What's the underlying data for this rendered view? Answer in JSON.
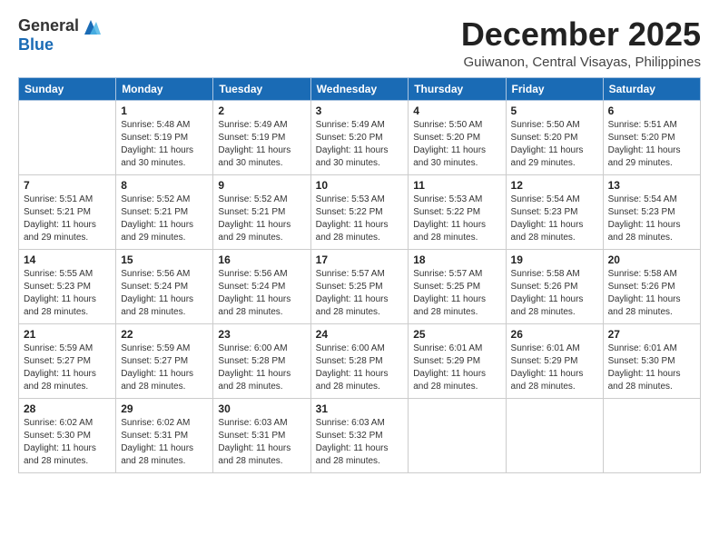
{
  "logo": {
    "general": "General",
    "blue": "Blue"
  },
  "title": "December 2025",
  "location": "Guiwanon, Central Visayas, Philippines",
  "days_of_week": [
    "Sunday",
    "Monday",
    "Tuesday",
    "Wednesday",
    "Thursday",
    "Friday",
    "Saturday"
  ],
  "weeks": [
    [
      {
        "day": "",
        "info": ""
      },
      {
        "day": "1",
        "info": "Sunrise: 5:48 AM\nSunset: 5:19 PM\nDaylight: 11 hours\nand 30 minutes."
      },
      {
        "day": "2",
        "info": "Sunrise: 5:49 AM\nSunset: 5:19 PM\nDaylight: 11 hours\nand 30 minutes."
      },
      {
        "day": "3",
        "info": "Sunrise: 5:49 AM\nSunset: 5:20 PM\nDaylight: 11 hours\nand 30 minutes."
      },
      {
        "day": "4",
        "info": "Sunrise: 5:50 AM\nSunset: 5:20 PM\nDaylight: 11 hours\nand 30 minutes."
      },
      {
        "day": "5",
        "info": "Sunrise: 5:50 AM\nSunset: 5:20 PM\nDaylight: 11 hours\nand 29 minutes."
      },
      {
        "day": "6",
        "info": "Sunrise: 5:51 AM\nSunset: 5:20 PM\nDaylight: 11 hours\nand 29 minutes."
      }
    ],
    [
      {
        "day": "7",
        "info": "Sunrise: 5:51 AM\nSunset: 5:21 PM\nDaylight: 11 hours\nand 29 minutes."
      },
      {
        "day": "8",
        "info": "Sunrise: 5:52 AM\nSunset: 5:21 PM\nDaylight: 11 hours\nand 29 minutes."
      },
      {
        "day": "9",
        "info": "Sunrise: 5:52 AM\nSunset: 5:21 PM\nDaylight: 11 hours\nand 29 minutes."
      },
      {
        "day": "10",
        "info": "Sunrise: 5:53 AM\nSunset: 5:22 PM\nDaylight: 11 hours\nand 28 minutes."
      },
      {
        "day": "11",
        "info": "Sunrise: 5:53 AM\nSunset: 5:22 PM\nDaylight: 11 hours\nand 28 minutes."
      },
      {
        "day": "12",
        "info": "Sunrise: 5:54 AM\nSunset: 5:23 PM\nDaylight: 11 hours\nand 28 minutes."
      },
      {
        "day": "13",
        "info": "Sunrise: 5:54 AM\nSunset: 5:23 PM\nDaylight: 11 hours\nand 28 minutes."
      }
    ],
    [
      {
        "day": "14",
        "info": "Sunrise: 5:55 AM\nSunset: 5:23 PM\nDaylight: 11 hours\nand 28 minutes."
      },
      {
        "day": "15",
        "info": "Sunrise: 5:56 AM\nSunset: 5:24 PM\nDaylight: 11 hours\nand 28 minutes."
      },
      {
        "day": "16",
        "info": "Sunrise: 5:56 AM\nSunset: 5:24 PM\nDaylight: 11 hours\nand 28 minutes."
      },
      {
        "day": "17",
        "info": "Sunrise: 5:57 AM\nSunset: 5:25 PM\nDaylight: 11 hours\nand 28 minutes."
      },
      {
        "day": "18",
        "info": "Sunrise: 5:57 AM\nSunset: 5:25 PM\nDaylight: 11 hours\nand 28 minutes."
      },
      {
        "day": "19",
        "info": "Sunrise: 5:58 AM\nSunset: 5:26 PM\nDaylight: 11 hours\nand 28 minutes."
      },
      {
        "day": "20",
        "info": "Sunrise: 5:58 AM\nSunset: 5:26 PM\nDaylight: 11 hours\nand 28 minutes."
      }
    ],
    [
      {
        "day": "21",
        "info": "Sunrise: 5:59 AM\nSunset: 5:27 PM\nDaylight: 11 hours\nand 28 minutes."
      },
      {
        "day": "22",
        "info": "Sunrise: 5:59 AM\nSunset: 5:27 PM\nDaylight: 11 hours\nand 28 minutes."
      },
      {
        "day": "23",
        "info": "Sunrise: 6:00 AM\nSunset: 5:28 PM\nDaylight: 11 hours\nand 28 minutes."
      },
      {
        "day": "24",
        "info": "Sunrise: 6:00 AM\nSunset: 5:28 PM\nDaylight: 11 hours\nand 28 minutes."
      },
      {
        "day": "25",
        "info": "Sunrise: 6:01 AM\nSunset: 5:29 PM\nDaylight: 11 hours\nand 28 minutes."
      },
      {
        "day": "26",
        "info": "Sunrise: 6:01 AM\nSunset: 5:29 PM\nDaylight: 11 hours\nand 28 minutes."
      },
      {
        "day": "27",
        "info": "Sunrise: 6:01 AM\nSunset: 5:30 PM\nDaylight: 11 hours\nand 28 minutes."
      }
    ],
    [
      {
        "day": "28",
        "info": "Sunrise: 6:02 AM\nSunset: 5:30 PM\nDaylight: 11 hours\nand 28 minutes."
      },
      {
        "day": "29",
        "info": "Sunrise: 6:02 AM\nSunset: 5:31 PM\nDaylight: 11 hours\nand 28 minutes."
      },
      {
        "day": "30",
        "info": "Sunrise: 6:03 AM\nSunset: 5:31 PM\nDaylight: 11 hours\nand 28 minutes."
      },
      {
        "day": "31",
        "info": "Sunrise: 6:03 AM\nSunset: 5:32 PM\nDaylight: 11 hours\nand 28 minutes."
      },
      {
        "day": "",
        "info": ""
      },
      {
        "day": "",
        "info": ""
      },
      {
        "day": "",
        "info": ""
      }
    ]
  ]
}
